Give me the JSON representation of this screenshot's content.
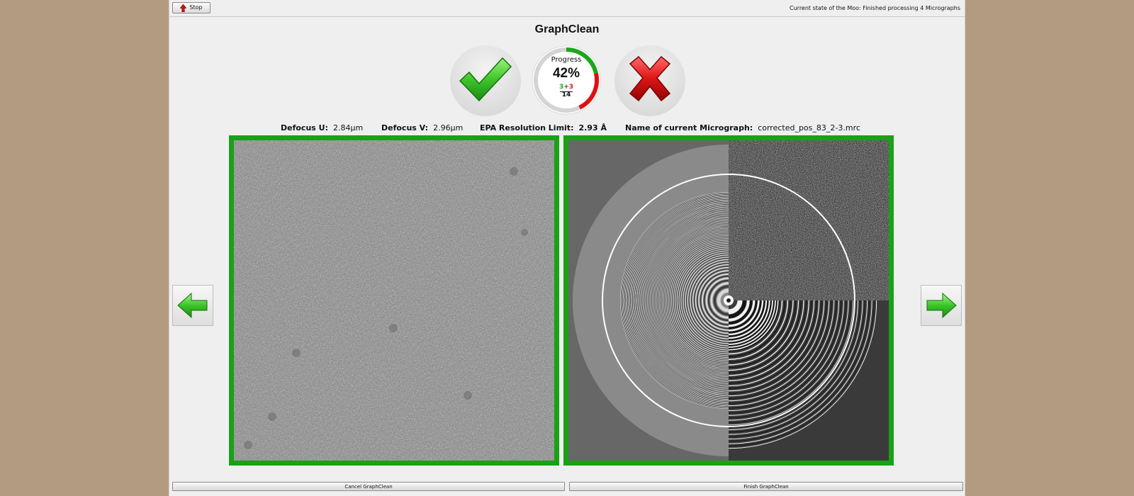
{
  "toolbar": {
    "stop_label": "Stop",
    "state_text": "Current state of the Moo:  Finished processing 4 Micrographs"
  },
  "title": "GraphClean",
  "progress": {
    "label": "Progress",
    "percent_text": "42%",
    "percent_value": 42,
    "accepted": "3",
    "separator": "+",
    "rejected": "3",
    "total": "14",
    "accepted_color": "#1aa81a",
    "rejected_color": "#dd1111"
  },
  "info": {
    "defocus_u_label": "Defocus U:",
    "defocus_u_value": "2.84µm",
    "defocus_v_label": "Defocus V:",
    "defocus_v_value": "2.96µm",
    "epa_label": "EPA Resolution Limit:",
    "epa_value": "2.93 Å",
    "name_label": "Name of current Micrograph:",
    "name_value": "corrected_pos_83_2-3.mrc"
  },
  "icons": {
    "accept": "checkmark-icon",
    "reject": "cross-icon",
    "prev": "arrow-left-icon",
    "next": "arrow-right-icon",
    "stop": "arrow-up-icon"
  },
  "colors": {
    "frame_green": "#1aa117",
    "window_bg": "#efefef",
    "desktop_bg": "#b39b82"
  },
  "buttons": {
    "cancel_label": "Cancel GraphClean",
    "finish_label": "Finish GraphClean"
  }
}
